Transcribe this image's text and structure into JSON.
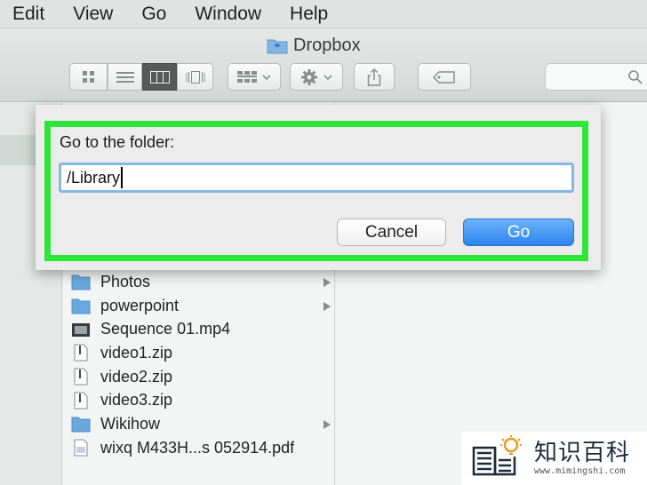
{
  "menubar": {
    "items": [
      "Edit",
      "View",
      "Go",
      "Window",
      "Help"
    ]
  },
  "window": {
    "title": "Dropbox"
  },
  "toolbar": {
    "view_buttons": [
      "icon-view",
      "list-view",
      "column-view",
      "coverflow-view"
    ],
    "active_view": "column-view",
    "arrange_icon": "arrange-icon",
    "action_icon": "gear-icon",
    "share_icon": "share-icon",
    "tag_icon": "tag-icon",
    "search_icon": "search-icon"
  },
  "files": [
    {
      "name": "Photos",
      "kind": "folder",
      "has_children": true
    },
    {
      "name": "powerpoint",
      "kind": "folder",
      "has_children": true
    },
    {
      "name": "Sequence 01.mp4",
      "kind": "video",
      "has_children": false
    },
    {
      "name": "video1.zip",
      "kind": "zip",
      "has_children": false
    },
    {
      "name": "video2.zip",
      "kind": "zip",
      "has_children": false
    },
    {
      "name": "video3.zip",
      "kind": "zip",
      "has_children": false
    },
    {
      "name": "Wikihow",
      "kind": "folder",
      "has_children": true
    },
    {
      "name": "wixq M433H...s 052914.pdf",
      "kind": "pdf",
      "has_children": false
    }
  ],
  "dialog": {
    "label": "Go to the folder:",
    "path_value": "/Library",
    "cancel_label": "Cancel",
    "go_label": "Go",
    "highlight_color": "#2ee63a",
    "go_color": "#2b84ee"
  },
  "watermark": {
    "title": "知识百科",
    "url": "www.mimingshi.com"
  }
}
